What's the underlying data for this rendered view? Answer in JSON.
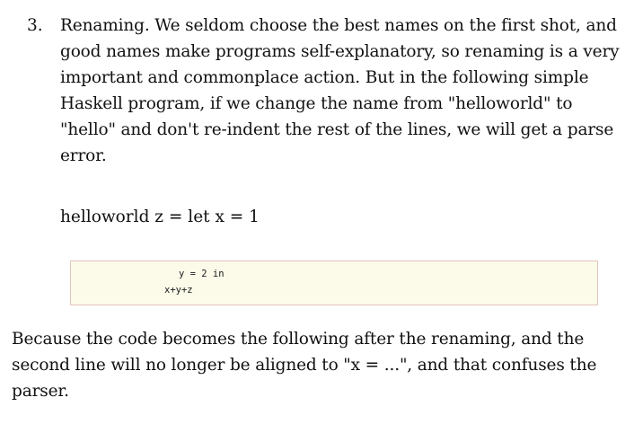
{
  "list_item": {
    "number": "3.",
    "lines": [
      "Renaming. We seldom choose the best names on the first shot, and",
      "good names make programs self-explanatory, so renaming is a very",
      "important and commonplace action. But in the following simple",
      "Haskell program, if we change the name from \"helloworld\" to",
      "\"hello\" and don't re-indent the rest of the lines, we will get a parse",
      "error."
    ]
  },
  "code_inline": "helloworld z = let x = 1",
  "code_block": {
    "lines": [
      "y = 2 in",
      "x+y+z"
    ]
  },
  "paragraph": {
    "lines": [
      "Because the code becomes the following after the renaming, and the",
      "second line will no longer be aligned to \"x = ...\", and that confuses the",
      "parser."
    ]
  }
}
